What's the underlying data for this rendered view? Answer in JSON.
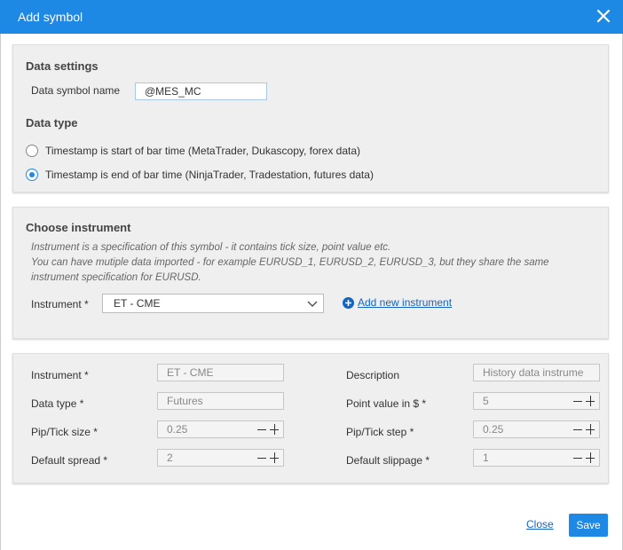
{
  "dialog": {
    "title": "Add symbol",
    "close_icon": "close-icon"
  },
  "data_settings": {
    "heading": "Data settings",
    "symbol_name_label": "Data symbol name",
    "symbol_name_value": "@MES_MC",
    "data_type_heading": "Data type",
    "options": [
      {
        "label": "Timestamp is start of bar time (MetaTrader, Dukascopy, forex data)",
        "selected": false
      },
      {
        "label": "Timestamp is end of bar time (NinjaTrader, Tradestation, futures data)",
        "selected": true
      }
    ]
  },
  "instrument": {
    "heading": "Choose instrument",
    "hint_line1": "Instrument is a specification of this symbol - it contains tick size, point value etc.",
    "hint_line2": "You can have mutiple data imported - for example EURUSD_1, EURUSD_2, EURUSD_3, but they share the same",
    "hint_line3": "instrument specification for EURUSD.",
    "select_label": "Instrument *",
    "select_value": "ET - CME",
    "add_new_label": "Add new instrument"
  },
  "details": {
    "instrument_label": "Instrument *",
    "instrument_value": "ET - CME",
    "description_label": "Description",
    "description_value": "History data instrume",
    "data_type_label": "Data type *",
    "data_type_value": "Futures",
    "point_value_label": "Point value in $ *",
    "point_value_value": "5",
    "pip_tick_size_label": "Pip/Tick size *",
    "pip_tick_size_value": "0.25",
    "pip_tick_step_label": "Pip/Tick step *",
    "pip_tick_step_value": "0.25",
    "default_spread_label": "Default spread *",
    "default_spread_value": "2",
    "default_slippage_label": "Default slippage *",
    "default_slippage_value": "1"
  },
  "footer": {
    "close_label": "Close",
    "save_label": "Save"
  },
  "colors": {
    "accent": "#1E88E5",
    "panel_bg": "#efefef",
    "link": "#1565c0"
  }
}
